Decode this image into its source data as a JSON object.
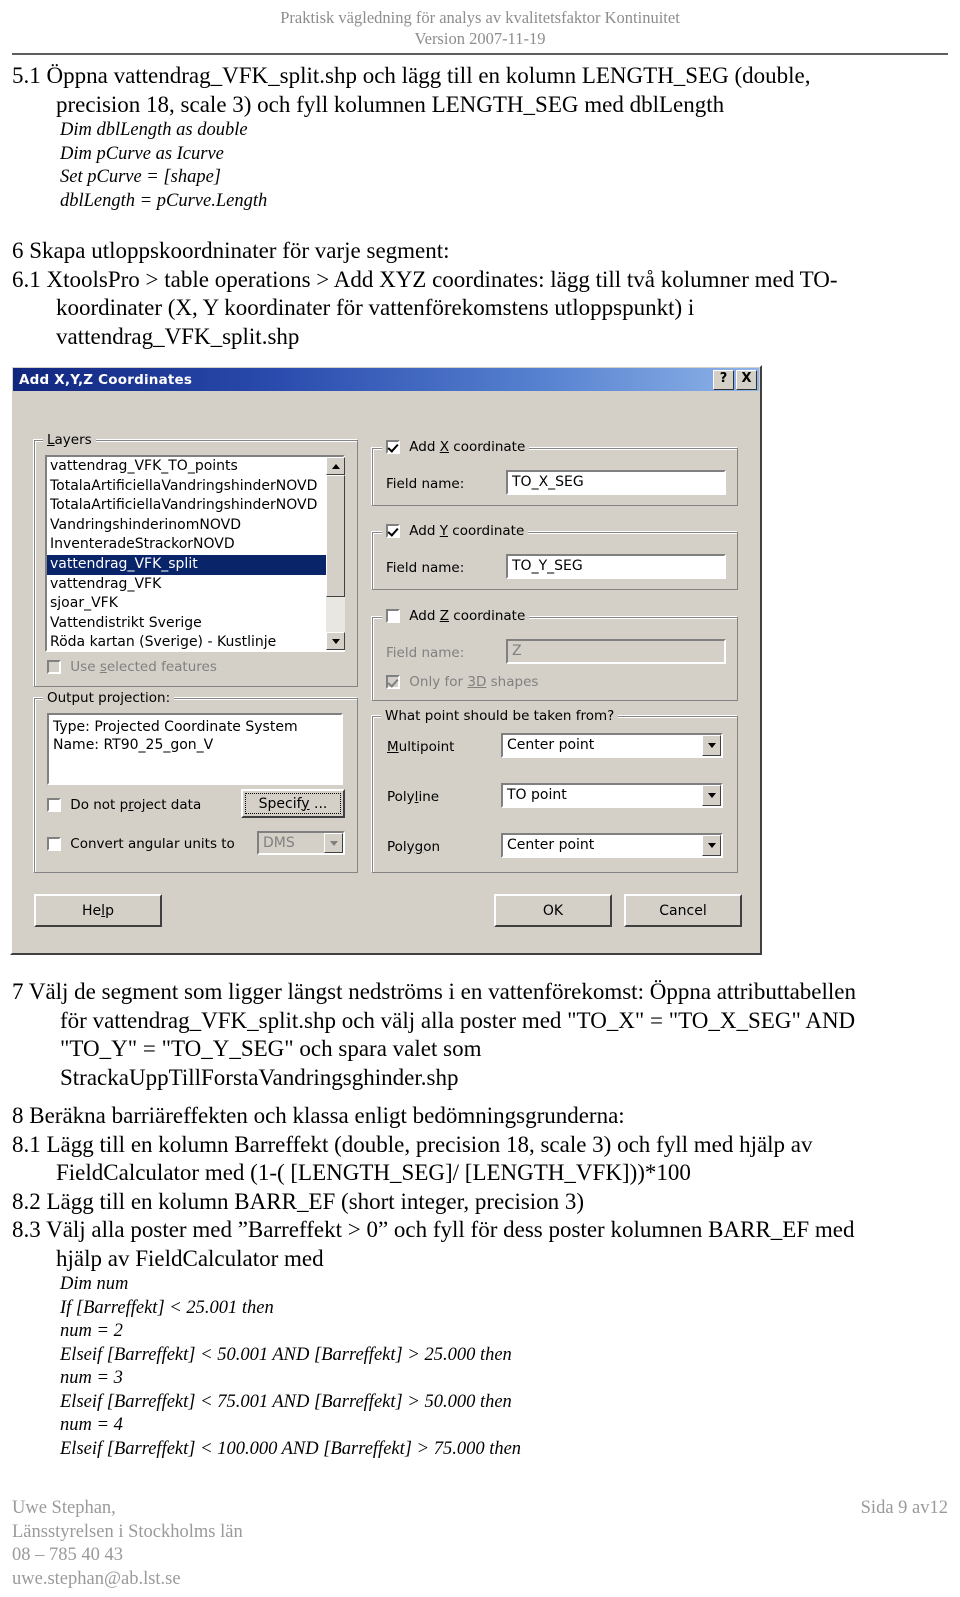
{
  "header": {
    "line1": "Praktisk vägledning för analys av kvalitetsfaktor Kontinuitet",
    "line2": "Version 2007-11-19"
  },
  "doc": {
    "step51_line1": "5.1 Öppna vattendrag_VFK_split.shp och lägg till en kolumn LENGTH_SEG (double,",
    "step51_line2": "precision 18, scale 3) och fyll kolumnen LENGTH_SEG med dblLength",
    "code51": [
      "Dim dblLength as double",
      "Dim pCurve as Icurve",
      "Set pCurve = [shape]",
      "dblLength = pCurve.Length"
    ],
    "step6": "6    Skapa utloppskoordninater för varje segment:",
    "step61_line1": "6.1 XtoolsPro > table operations > Add XYZ coordinates: lägg till två kolumner med TO-",
    "step61_line2": "koordinater (X, Y koordinater för vattenförekomstens utloppspunkt) i",
    "step61_line3": "vattendrag_VFK_split.shp",
    "step7_line1": "7     Välj de segment som ligger längst nedströms i en vattenförekomst: Öppna attributtabellen",
    "step7_line2": "för vattendrag_VFK_split.shp och välj alla poster med \"TO_X\" = \"TO_X_SEG\" AND",
    "step7_line3": "\"TO_Y\" = \"TO_Y_SEG\"  och spara valet som",
    "step7_line4": "StrackaUppTillForstaVandringsghinder.shp",
    "step8": "8    Beräkna barriäreffekten och klassa enligt bedömningsgrunderna:",
    "step81_line1": "8.1 Lägg till en kolumn Barreffekt  (double, precision 18, scale 3) och fyll med hjälp av",
    "step81_line2": "FieldCalculator med (1-( [LENGTH_SEG]/ [LENGTH_VFK]))*100",
    "step82": "8.2 Lägg till en kolumn BARR_EF (short integer, precision 3)",
    "step83_line1": "8.3 Välj alla poster med ”Barreffekt > 0” och fyll för dess poster kolumnen BARR_EF med",
    "step83_line2": "hjälp av FieldCalculator med",
    "code83": [
      "Dim num",
      "If [Barreffekt] < 25.001 then",
      "num = 2",
      "Elseif [Barreffekt] < 50.001 AND [Barreffekt] > 25.000 then",
      "num = 3",
      "Elseif [Barreffekt] < 75.001 AND [Barreffekt] > 50.000 then",
      "num = 4",
      "Elseif [Barreffekt] < 100.000 AND [Barreffekt] > 75.000 then"
    ]
  },
  "dialog": {
    "title": "Add X,Y,Z Coordinates",
    "help_btn_glyph": "?",
    "close_btn_glyph": "X",
    "layers_group_label": "Layers",
    "layers": [
      {
        "label": "vattendrag_VFK_TO_points",
        "selected": false
      },
      {
        "label": "TotalaArtificiellaVandringshinderNOVD",
        "selected": false
      },
      {
        "label": "TotalaArtificiellaVandringshinderNOVD",
        "selected": false
      },
      {
        "label": "VandringshinderinomNOVD",
        "selected": false
      },
      {
        "label": "InventeradeStrackorNOVD",
        "selected": false
      },
      {
        "label": "vattendrag_VFK_split",
        "selected": true
      },
      {
        "label": "vattendrag_VFK",
        "selected": false
      },
      {
        "label": "sjoar_VFK",
        "selected": false
      },
      {
        "label": "Vattendistrikt Sverige",
        "selected": false
      },
      {
        "label": "Röda kartan (Sverige) - Kustlinje",
        "selected": false
      }
    ],
    "use_selected_features": "Use selected features",
    "output_projection_label": "Output projection:",
    "projection_type": "Type: Projected Coordinate System",
    "projection_name": "Name: RT90_25_gon_V",
    "do_not_project": "Do not project data",
    "specify_btn": "Specify ...",
    "convert_angular": "Convert angular units to",
    "angular_units_value": "DMS",
    "add_x_label": "Add X coordinate",
    "add_y_label": "Add Y coordinate",
    "add_z_label": "Add Z coordinate",
    "field_name_label": "Field name:",
    "x_field_value": "TO_X_SEG",
    "y_field_value": "TO_Y_SEG",
    "z_field_value": "Z",
    "only_3d_label": "Only for 3D shapes",
    "what_point_label": "What point should be taken from?",
    "multipoint_label": "Multipoint",
    "multipoint_value": "Center point",
    "polyline_label": "Polyline",
    "polyline_value": "TO point",
    "polygon_label": "Polygon",
    "polygon_value": "Center point",
    "help_button": "Help",
    "ok_button": "OK",
    "cancel_button": "Cancel"
  },
  "footer": {
    "name": "Uwe Stephan,",
    "org": "Länsstyrelsen i Stockholms län",
    "phone": "08 – 785 40 43",
    "email": "uwe.stephan@ab.lst.se",
    "page": "Sida 9 av12"
  }
}
